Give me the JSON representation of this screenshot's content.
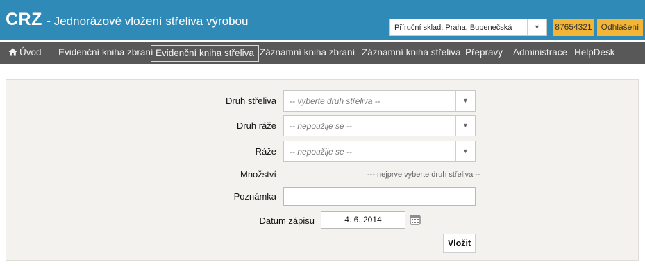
{
  "header": {
    "logo": "CRZ",
    "subtitle": "- Jednorázové vložení střeliva výrobou",
    "warehouse": "Příruční sklad, Praha, Bubenečská",
    "user_id": "87654321",
    "logout_label": "Odhlášení"
  },
  "nav": {
    "items": [
      {
        "label": "Úvod",
        "icon": "home-icon"
      },
      {
        "label": "Evidenční kniha zbraní"
      },
      {
        "label": "Evidenční kniha střeliva",
        "active": true
      },
      {
        "label": "Záznamní kniha zbraní"
      },
      {
        "label": "Záznamní kniha střeliva"
      },
      {
        "label": "Přepravy"
      },
      {
        "label": "Administrace"
      },
      {
        "label": "HelpDesk"
      }
    ]
  },
  "form": {
    "ammo_type": {
      "label": "Druh střeliva",
      "value": "-- vyberte druh střeliva --"
    },
    "caliber_type": {
      "label": "Druh ráže",
      "value": "-- nepoužije se --"
    },
    "caliber": {
      "label": "Ráže",
      "value": "-- nepoužije se --"
    },
    "quantity": {
      "label": "Množství",
      "hint": "--- nejprve vyberte druh střeliva --"
    },
    "note": {
      "label": "Poznámka",
      "value": ""
    },
    "date": {
      "label": "Datum zápisu",
      "value": "4. 6. 2014"
    },
    "submit_label": "Vložit"
  },
  "colors": {
    "header_bg": "#2f8ab8",
    "nav_bg": "#585858",
    "accent_orange": "#f2b535",
    "panel_bg": "#f4f2ee"
  }
}
